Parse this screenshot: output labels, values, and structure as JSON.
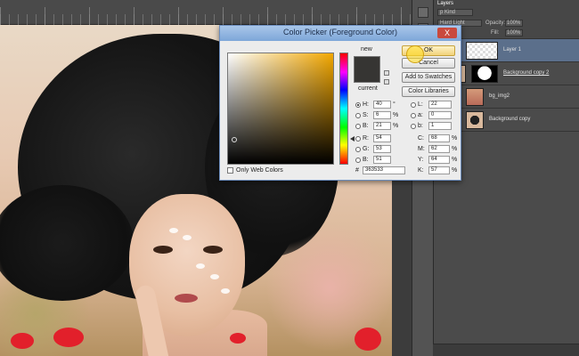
{
  "dialog": {
    "title": "Color Picker (Foreground Color)",
    "close_label": "X",
    "ok_label": "OK",
    "cancel_label": "Cancel",
    "new_label": "new",
    "current_label": "current",
    "add_swatches_label": "Add to Swatches",
    "color_libraries_label": "Color Libraries",
    "only_web_colors_label": "Only Web Colors",
    "new_color": "#363533",
    "hsb": {
      "h_label": "H:",
      "h_value": "40",
      "h_unit": "°",
      "s_label": "S:",
      "s_value": "6",
      "s_unit": "%",
      "b_label": "B:",
      "b_value": "21",
      "b_unit": "%"
    },
    "rgb": {
      "r_label": "R:",
      "r_value": "54",
      "g_label": "G:",
      "g_value": "53",
      "b_label": "B:",
      "b_value": "51"
    },
    "lab": {
      "l_label": "L:",
      "l_value": "22",
      "a_label": "a:",
      "a_value": "0",
      "b_label": "b:",
      "b_value": "1"
    },
    "cmyk": {
      "c_label": "C:",
      "c_value": "68",
      "c_unit": "%",
      "m_label": "M:",
      "m_value": "62",
      "m_unit": "%",
      "y_label": "Y:",
      "y_value": "64",
      "y_unit": "%",
      "k_label": "K:",
      "k_value": "57",
      "k_unit": "%"
    },
    "hex_label": "#",
    "hex_value": "363533"
  },
  "layers_panel": {
    "tab_label": "Layers",
    "kind_label": "p Kind",
    "blend_mode": "Hard Light",
    "opacity_label": "Opacity:",
    "opacity_value": "100%",
    "fill_label": "Fill:",
    "fill_value": "100%",
    "layers": [
      {
        "name": "Layer 1",
        "selected": true
      },
      {
        "name": "Background copy 2",
        "selected": false
      },
      {
        "name": "bg_img2",
        "selected": false
      },
      {
        "name": "Background copy",
        "selected": false
      }
    ]
  }
}
